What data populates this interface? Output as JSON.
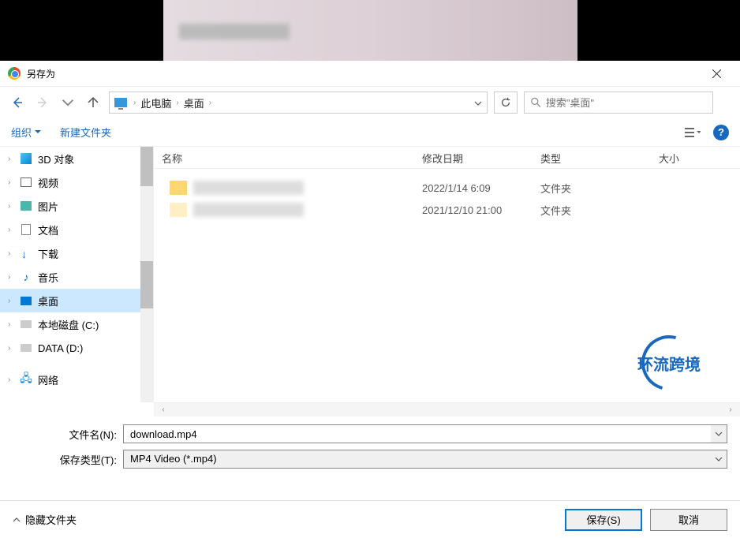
{
  "dialog": {
    "title": "另存为"
  },
  "nav": {
    "breadcrumb1": "此电脑",
    "breadcrumb2": "桌面"
  },
  "search": {
    "placeholder": "搜索\"桌面\""
  },
  "toolbar": {
    "organize": "组织",
    "newfolder": "新建文件夹"
  },
  "sidebar": {
    "items": [
      {
        "label": "3D 对象",
        "icon": "3d"
      },
      {
        "label": "视频",
        "icon": "video"
      },
      {
        "label": "图片",
        "icon": "pic"
      },
      {
        "label": "文档",
        "icon": "doc"
      },
      {
        "label": "下载",
        "icon": "dl"
      },
      {
        "label": "音乐",
        "icon": "music"
      },
      {
        "label": "桌面",
        "icon": "desktop",
        "selected": true
      },
      {
        "label": "本地磁盘 (C:)",
        "icon": "disk"
      },
      {
        "label": "DATA (D:)",
        "icon": "disk"
      }
    ],
    "network": "网络"
  },
  "columns": {
    "name": "名称",
    "date": "修改日期",
    "type": "类型",
    "size": "大小"
  },
  "files": [
    {
      "date": "2022/1/14 6:09",
      "type": "文件夹"
    },
    {
      "date": "2021/12/10 21:00",
      "type": "文件夹"
    }
  ],
  "watermark": "环流跨境",
  "form": {
    "filename_label": "文件名(N):",
    "filename_value": "download.mp4",
    "filetype_label": "保存类型(T):",
    "filetype_value": "MP4 Video (*.mp4)"
  },
  "bottom": {
    "hide_folders": "隐藏文件夹",
    "save": "保存(S)",
    "cancel": "取消"
  }
}
